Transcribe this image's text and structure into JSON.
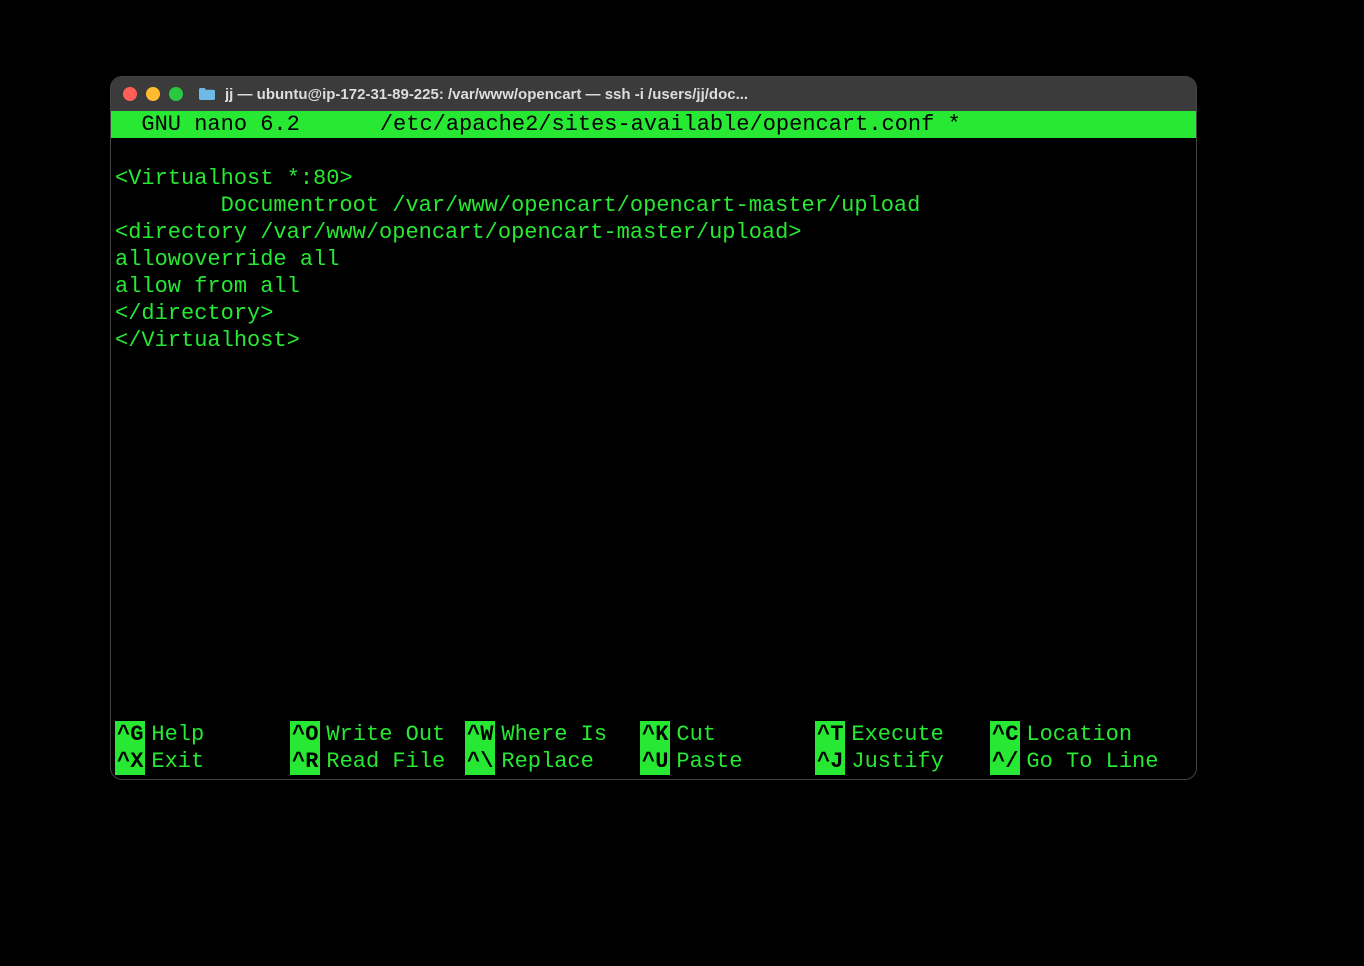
{
  "window": {
    "title": "jj — ubuntu@ip-172-31-89-225: /var/www/opencart — ssh -i /users/jj/doc..."
  },
  "nano": {
    "app": "  GNU nano 6.2",
    "file": "/etc/apache2/sites-available/opencart.conf *"
  },
  "editor_lines": [
    "<Virtualhost *:80>",
    "        Documentroot /var/www/opencart/opencart-master/upload",
    "<directory /var/www/opencart/opencart-master/upload>",
    "allowoverride all",
    "allow from all",
    "</directory>",
    "</Virtualhost>"
  ],
  "shortcuts": {
    "row1": [
      {
        "k": "^G",
        "l": "Help"
      },
      {
        "k": "^O",
        "l": "Write Out"
      },
      {
        "k": "^W",
        "l": "Where Is"
      },
      {
        "k": "^K",
        "l": "Cut"
      },
      {
        "k": "^T",
        "l": "Execute"
      },
      {
        "k": "^C",
        "l": "Location"
      }
    ],
    "row2": [
      {
        "k": "^X",
        "l": "Exit"
      },
      {
        "k": "^R",
        "l": "Read File"
      },
      {
        "k": "^\\",
        "l": "Replace"
      },
      {
        "k": "^U",
        "l": "Paste"
      },
      {
        "k": "^J",
        "l": "Justify"
      },
      {
        "k": "^/",
        "l": "Go To Line"
      }
    ]
  }
}
